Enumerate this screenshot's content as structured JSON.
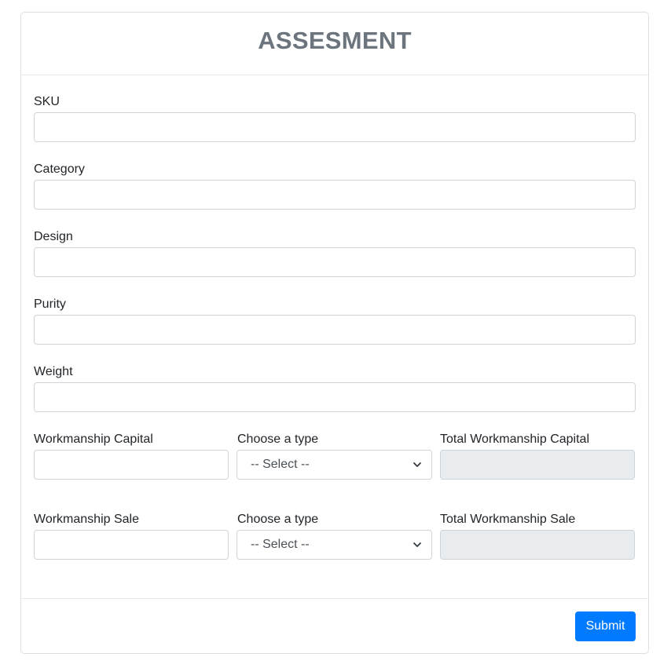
{
  "header": {
    "title": "ASSESMENT"
  },
  "fields": {
    "sku": {
      "label": "SKU",
      "value": ""
    },
    "category": {
      "label": "Category",
      "value": ""
    },
    "design": {
      "label": "Design",
      "value": ""
    },
    "purity": {
      "label": "Purity",
      "value": ""
    },
    "weight": {
      "label": "Weight",
      "value": ""
    }
  },
  "capital_row": {
    "workmanship_label": "Workmanship Capital",
    "workmanship_value": "",
    "type_label": "Choose a type",
    "type_selected": "-- Select --",
    "total_label": "Total Workmanship Capital",
    "total_value": ""
  },
  "sale_row": {
    "workmanship_label": "Workmanship Sale",
    "workmanship_value": "",
    "type_label": "Choose a type",
    "type_selected": "-- Select --",
    "total_label": "Total Workmanship Sale",
    "total_value": ""
  },
  "footer": {
    "submit_label": "Submit"
  },
  "colors": {
    "primary": "#007bff",
    "title": "#6c757d",
    "disabled_bg": "#e9ecef",
    "border": "#ced4da"
  }
}
